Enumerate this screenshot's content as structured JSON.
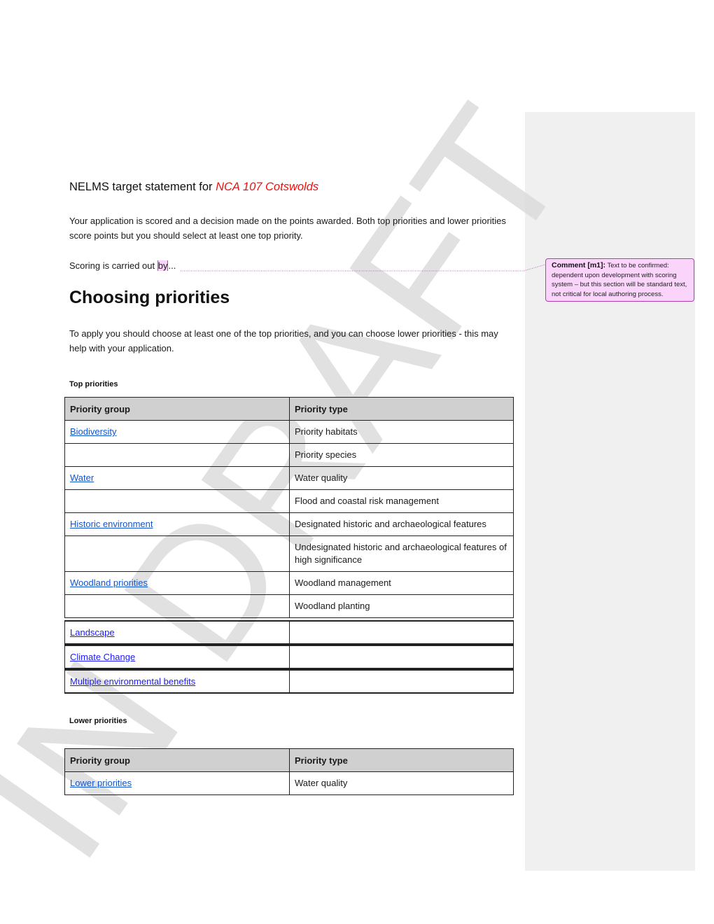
{
  "document": {
    "title_prefix": "NELMS target statement for ",
    "title_area": "NCA 107 Cotswolds",
    "intro_paragraph": "Your application is scored and a decision made on the points awarded. Both top priorities and lower priorities score points but you should select at least one top priority.",
    "scoring_prefix": "Scoring is carried out ",
    "scoring_highlight": "by",
    "scoring_suffix": "...",
    "section_heading": "Choosing priorities",
    "section_paragraph": "To apply you should choose at least one of the top priorities, and you can choose lower priorities - this may help with your application.",
    "watermark": "IN DRAFT"
  },
  "comment": {
    "label": "Comment [m1]:",
    "text": " Text to be confirmed: dependent upon development with scoring system – but this section will be standard text, not critical for local authoring process."
  },
  "top_priorities": {
    "heading": "Top priorities",
    "columns": [
      "Priority group",
      "Priority type"
    ],
    "rows": [
      {
        "group": "Biodiversity",
        "type": "Priority habitats"
      },
      {
        "group": "",
        "type": "Priority species"
      },
      {
        "group": "Water",
        "type": "Water quality"
      },
      {
        "group": "",
        "type": "Flood and coastal risk management"
      },
      {
        "group": "Historic environment",
        "type": "Designated historic and archaeological features"
      },
      {
        "group": "",
        "type": "Undesignated historic and archaeological features of high significance"
      },
      {
        "group": "Woodland priorities",
        "type": "Woodland management"
      },
      {
        "group": "",
        "type": "Woodland planting"
      },
      {
        "group": "Landscape",
        "type": ""
      },
      {
        "group": "Climate Change",
        "type": ""
      },
      {
        "group": "Multiple environmental benefits",
        "type": ""
      }
    ]
  },
  "lower_priorities": {
    "heading": "Lower priorities",
    "columns": [
      "Priority group",
      "Priority type"
    ],
    "rows": [
      {
        "group": "Lower priorities",
        "type": "Water quality"
      }
    ]
  },
  "colors": {
    "link": "#1155cc",
    "link_bright": "#1a1aff",
    "area_highlight": "#ee1111",
    "comment_fill": "#fbd4fb",
    "comment_border": "#b040b0",
    "margin_pane": "#f0f0f0",
    "header_fill": "#d0d0d0"
  }
}
